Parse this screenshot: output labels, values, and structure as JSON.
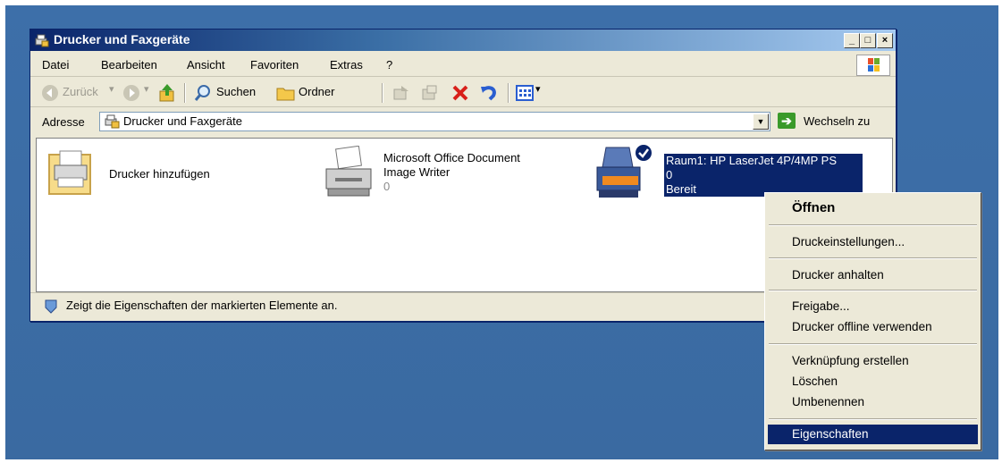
{
  "window": {
    "title": "Drucker und Faxgeräte",
    "buttons": {
      "minimize": "_",
      "maximize": "□",
      "close": "×"
    }
  },
  "menu": [
    {
      "label": "Datei"
    },
    {
      "label": "Bearbeiten"
    },
    {
      "label": "Ansicht"
    },
    {
      "label": "Favoriten"
    },
    {
      "label": "Extras"
    },
    {
      "label": "?"
    }
  ],
  "toolbar": {
    "back_label": "Zurück",
    "search_label": "Suchen",
    "folders_label": "Ordner"
  },
  "address": {
    "label": "Adresse",
    "value": "Drucker und Faxgeräte",
    "go_label": "Wechseln zu"
  },
  "printers": [
    {
      "name": "Drucker hinzufügen"
    },
    {
      "name_line1": "Microsoft Office Document",
      "name_line2": "Image Writer",
      "count": "0"
    },
    {
      "name": "Raum1: HP LaserJet 4P/4MP PS",
      "count": "0",
      "status": "Bereit"
    }
  ],
  "status": {
    "text": "Zeigt die Eigenschaften der markierten Elemente an."
  },
  "context_menu": [
    {
      "label": "Öffnen"
    },
    {
      "label": "Druckeinstellungen..."
    },
    {
      "label": "Drucker anhalten"
    },
    {
      "label": "Freigabe..."
    },
    {
      "label": "Drucker offline verwenden"
    },
    {
      "label": "Verknüpfung erstellen"
    },
    {
      "label": "Löschen"
    },
    {
      "label": "Umbenennen"
    },
    {
      "label": "Eigenschaften"
    }
  ],
  "colors": {
    "selection": "#0a246a",
    "desktop": "#3a6ea5",
    "title_start": "#0a246a"
  }
}
